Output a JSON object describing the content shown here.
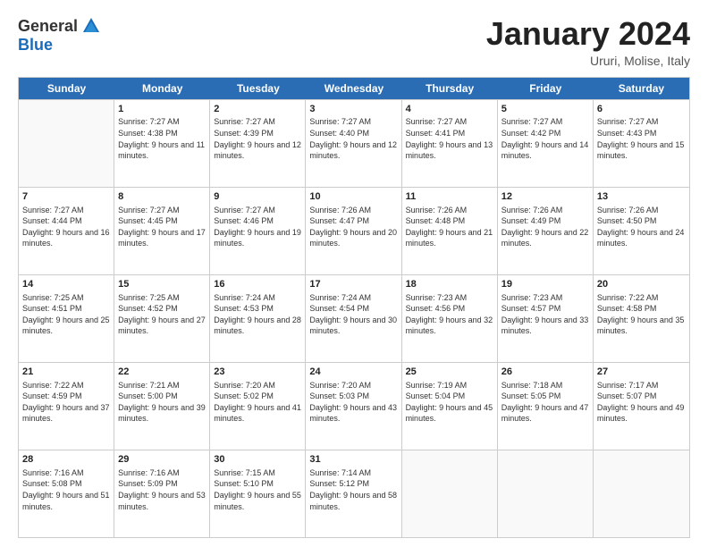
{
  "logo": {
    "general": "General",
    "blue": "Blue"
  },
  "title": "January 2024",
  "location": "Ururi, Molise, Italy",
  "days_of_week": [
    "Sunday",
    "Monday",
    "Tuesday",
    "Wednesday",
    "Thursday",
    "Friday",
    "Saturday"
  ],
  "weeks": [
    [
      {
        "day": "",
        "sunrise": "",
        "sunset": "",
        "daylight": "",
        "empty": true
      },
      {
        "day": "1",
        "sunrise": "Sunrise: 7:27 AM",
        "sunset": "Sunset: 4:38 PM",
        "daylight": "Daylight: 9 hours and 11 minutes."
      },
      {
        "day": "2",
        "sunrise": "Sunrise: 7:27 AM",
        "sunset": "Sunset: 4:39 PM",
        "daylight": "Daylight: 9 hours and 12 minutes."
      },
      {
        "day": "3",
        "sunrise": "Sunrise: 7:27 AM",
        "sunset": "Sunset: 4:40 PM",
        "daylight": "Daylight: 9 hours and 12 minutes."
      },
      {
        "day": "4",
        "sunrise": "Sunrise: 7:27 AM",
        "sunset": "Sunset: 4:41 PM",
        "daylight": "Daylight: 9 hours and 13 minutes."
      },
      {
        "day": "5",
        "sunrise": "Sunrise: 7:27 AM",
        "sunset": "Sunset: 4:42 PM",
        "daylight": "Daylight: 9 hours and 14 minutes."
      },
      {
        "day": "6",
        "sunrise": "Sunrise: 7:27 AM",
        "sunset": "Sunset: 4:43 PM",
        "daylight": "Daylight: 9 hours and 15 minutes."
      }
    ],
    [
      {
        "day": "7",
        "sunrise": "Sunrise: 7:27 AM",
        "sunset": "Sunset: 4:44 PM",
        "daylight": "Daylight: 9 hours and 16 minutes."
      },
      {
        "day": "8",
        "sunrise": "Sunrise: 7:27 AM",
        "sunset": "Sunset: 4:45 PM",
        "daylight": "Daylight: 9 hours and 17 minutes."
      },
      {
        "day": "9",
        "sunrise": "Sunrise: 7:27 AM",
        "sunset": "Sunset: 4:46 PM",
        "daylight": "Daylight: 9 hours and 19 minutes."
      },
      {
        "day": "10",
        "sunrise": "Sunrise: 7:26 AM",
        "sunset": "Sunset: 4:47 PM",
        "daylight": "Daylight: 9 hours and 20 minutes."
      },
      {
        "day": "11",
        "sunrise": "Sunrise: 7:26 AM",
        "sunset": "Sunset: 4:48 PM",
        "daylight": "Daylight: 9 hours and 21 minutes."
      },
      {
        "day": "12",
        "sunrise": "Sunrise: 7:26 AM",
        "sunset": "Sunset: 4:49 PM",
        "daylight": "Daylight: 9 hours and 22 minutes."
      },
      {
        "day": "13",
        "sunrise": "Sunrise: 7:26 AM",
        "sunset": "Sunset: 4:50 PM",
        "daylight": "Daylight: 9 hours and 24 minutes."
      }
    ],
    [
      {
        "day": "14",
        "sunrise": "Sunrise: 7:25 AM",
        "sunset": "Sunset: 4:51 PM",
        "daylight": "Daylight: 9 hours and 25 minutes."
      },
      {
        "day": "15",
        "sunrise": "Sunrise: 7:25 AM",
        "sunset": "Sunset: 4:52 PM",
        "daylight": "Daylight: 9 hours and 27 minutes."
      },
      {
        "day": "16",
        "sunrise": "Sunrise: 7:24 AM",
        "sunset": "Sunset: 4:53 PM",
        "daylight": "Daylight: 9 hours and 28 minutes."
      },
      {
        "day": "17",
        "sunrise": "Sunrise: 7:24 AM",
        "sunset": "Sunset: 4:54 PM",
        "daylight": "Daylight: 9 hours and 30 minutes."
      },
      {
        "day": "18",
        "sunrise": "Sunrise: 7:23 AM",
        "sunset": "Sunset: 4:56 PM",
        "daylight": "Daylight: 9 hours and 32 minutes."
      },
      {
        "day": "19",
        "sunrise": "Sunrise: 7:23 AM",
        "sunset": "Sunset: 4:57 PM",
        "daylight": "Daylight: 9 hours and 33 minutes."
      },
      {
        "day": "20",
        "sunrise": "Sunrise: 7:22 AM",
        "sunset": "Sunset: 4:58 PM",
        "daylight": "Daylight: 9 hours and 35 minutes."
      }
    ],
    [
      {
        "day": "21",
        "sunrise": "Sunrise: 7:22 AM",
        "sunset": "Sunset: 4:59 PM",
        "daylight": "Daylight: 9 hours and 37 minutes."
      },
      {
        "day": "22",
        "sunrise": "Sunrise: 7:21 AM",
        "sunset": "Sunset: 5:00 PM",
        "daylight": "Daylight: 9 hours and 39 minutes."
      },
      {
        "day": "23",
        "sunrise": "Sunrise: 7:20 AM",
        "sunset": "Sunset: 5:02 PM",
        "daylight": "Daylight: 9 hours and 41 minutes."
      },
      {
        "day": "24",
        "sunrise": "Sunrise: 7:20 AM",
        "sunset": "Sunset: 5:03 PM",
        "daylight": "Daylight: 9 hours and 43 minutes."
      },
      {
        "day": "25",
        "sunrise": "Sunrise: 7:19 AM",
        "sunset": "Sunset: 5:04 PM",
        "daylight": "Daylight: 9 hours and 45 minutes."
      },
      {
        "day": "26",
        "sunrise": "Sunrise: 7:18 AM",
        "sunset": "Sunset: 5:05 PM",
        "daylight": "Daylight: 9 hours and 47 minutes."
      },
      {
        "day": "27",
        "sunrise": "Sunrise: 7:17 AM",
        "sunset": "Sunset: 5:07 PM",
        "daylight": "Daylight: 9 hours and 49 minutes."
      }
    ],
    [
      {
        "day": "28",
        "sunrise": "Sunrise: 7:16 AM",
        "sunset": "Sunset: 5:08 PM",
        "daylight": "Daylight: 9 hours and 51 minutes."
      },
      {
        "day": "29",
        "sunrise": "Sunrise: 7:16 AM",
        "sunset": "Sunset: 5:09 PM",
        "daylight": "Daylight: 9 hours and 53 minutes."
      },
      {
        "day": "30",
        "sunrise": "Sunrise: 7:15 AM",
        "sunset": "Sunset: 5:10 PM",
        "daylight": "Daylight: 9 hours and 55 minutes."
      },
      {
        "day": "31",
        "sunrise": "Sunrise: 7:14 AM",
        "sunset": "Sunset: 5:12 PM",
        "daylight": "Daylight: 9 hours and 58 minutes."
      },
      {
        "day": "",
        "sunrise": "",
        "sunset": "",
        "daylight": "",
        "empty": true
      },
      {
        "day": "",
        "sunrise": "",
        "sunset": "",
        "daylight": "",
        "empty": true
      },
      {
        "day": "",
        "sunrise": "",
        "sunset": "",
        "daylight": "",
        "empty": true
      }
    ]
  ]
}
